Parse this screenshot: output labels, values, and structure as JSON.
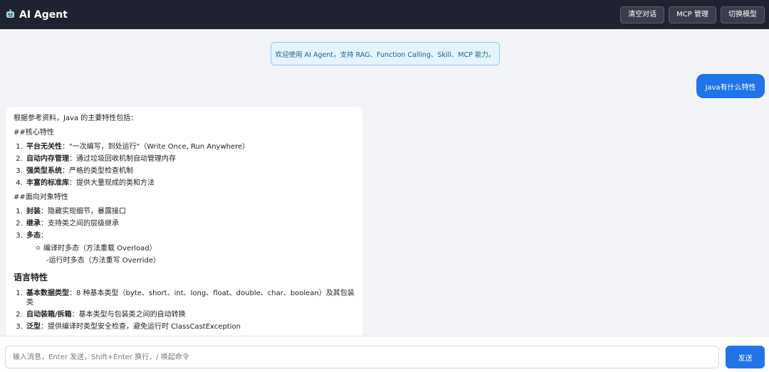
{
  "header": {
    "title": "AI Agent",
    "logo_icon": "robot-icon",
    "buttons": {
      "clear": "清空对话",
      "mcp": "MCP 管理",
      "model": "切换模型"
    }
  },
  "welcome": "欢迎使用 AI Agent，支持 RAG、Function Calling、Skill、MCP 能力。",
  "user_message": "Java有什么特性",
  "assistant": {
    "intro": "根据参考资料，Java 的主要特性包括：",
    "section1_heading": "##核心特性",
    "core": [
      {
        "bold": "平台无关性",
        "text": "：\"一次编写，到处运行\"（Write Once, Run Anywhere）"
      },
      {
        "bold": "自动内存管理",
        "text": "：通过垃圾回收机制自动管理内存"
      },
      {
        "bold": "强类型系统",
        "text": "：严格的类型检查机制"
      },
      {
        "bold": "丰富的标准库",
        "text": "：提供大量现成的类和方法"
      }
    ],
    "section2_heading": "##面向对象特性",
    "oop": [
      {
        "bold": "封装",
        "text": "：隐藏实现细节，暴露接口"
      },
      {
        "bold": "继承",
        "text": "：支持类之间的层级继承"
      },
      {
        "bold": "多态",
        "text": "："
      }
    ],
    "poly_sub1": "编译时多态（方法重载 Overload）",
    "poly_sub2": "-运行时多态（方法重写 Override）",
    "section3_heading": "语言特性",
    "lang": [
      {
        "bold": "基本数据类型",
        "text": "：8 种基本类型（byte、short、int、long、float、double、char、boolean）及其包装类"
      },
      {
        "bold": "自动装箱/拆箱",
        "text": "：基本类型与包装类之间的自动转换"
      },
      {
        "bold": "泛型",
        "text": "：提供编译时类型安全检查，避免运行时 ClassCastException"
      }
    ]
  },
  "input": {
    "placeholder": "输入消息，Enter 发送，Shift+Enter 换行，/ 唤起命令",
    "value": ""
  },
  "send_label": "发送",
  "colors": {
    "header_bg": "#1f2231",
    "accent": "#1e74e8",
    "welcome_bg": "#e4f3fd"
  }
}
